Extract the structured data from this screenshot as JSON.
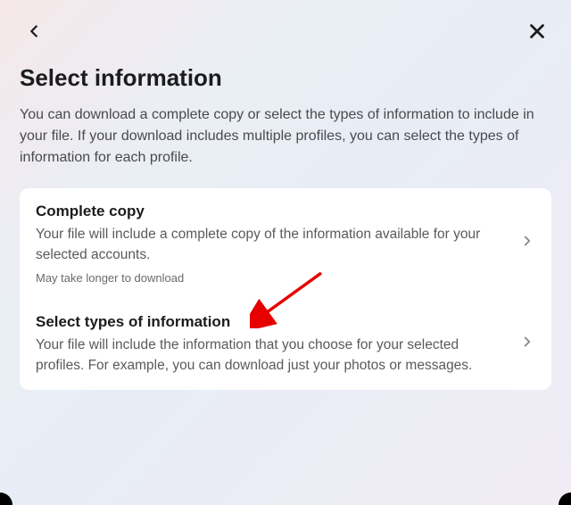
{
  "page": {
    "title": "Select information",
    "description": "You can download a complete copy or select the types of information to include in your file. If your download includes multiple profiles, you can select the types of information for each profile."
  },
  "options": {
    "complete": {
      "title": "Complete copy",
      "description": "Your file will include a complete copy of the information available for your selected accounts.",
      "note": "May take longer to download"
    },
    "select": {
      "title": "Select types of information",
      "description": "Your file will include the information that you choose for your selected profiles. For example, you can download just your photos or messages."
    }
  }
}
